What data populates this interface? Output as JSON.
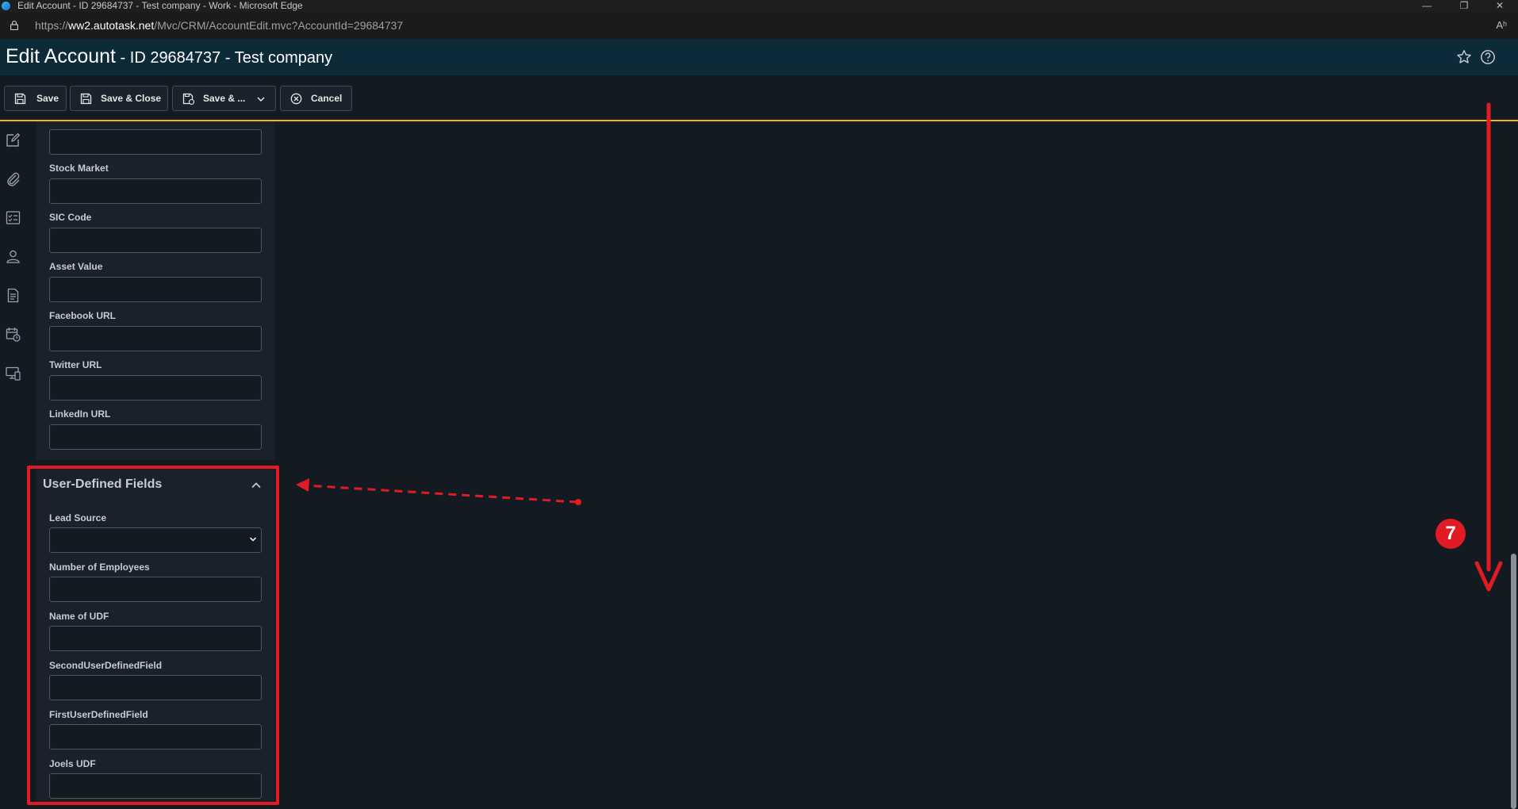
{
  "os": {
    "window_title": "Edit Account - ID 29684737 - Test company - Work - Microsoft Edge",
    "minimize": "—",
    "restore": "❐",
    "close": "✕"
  },
  "browser": {
    "url_prefix": "https://",
    "url_host": "ww2.autotask.net",
    "url_path": "/Mvc/CRM/AccountEdit.mvc?AccountId=29684737",
    "read_aloud": "Aʰ"
  },
  "header": {
    "title_main": "Edit Account",
    "title_sub": " - ID 29684737 - Test company"
  },
  "toolbar": {
    "save_label": "Save",
    "save_close_label": "Save & Close",
    "save_more_label": "Save & ...",
    "cancel_label": "Cancel"
  },
  "general_fields": [
    {
      "label": ""
    },
    {
      "label": "Stock Market"
    },
    {
      "label": "SIC Code"
    },
    {
      "label": "Asset Value"
    },
    {
      "label": "Facebook URL"
    },
    {
      "label": "Twitter URL"
    },
    {
      "label": "LinkedIn URL"
    }
  ],
  "udf": {
    "title": "User-Defined Fields",
    "lead_source_label": "Lead Source",
    "lead_source_value": "",
    "fields": [
      {
        "label": "Number of Employees"
      },
      {
        "label": "Name of UDF"
      },
      {
        "label": "SecondUserDefinedField"
      },
      {
        "label": "FirstUserDefinedField"
      },
      {
        "label": "Joels UDF"
      }
    ]
  },
  "annotation": {
    "step_number": "7",
    "color": "#e01b24"
  },
  "colors": {
    "header_bg": "#0d2a38",
    "page_bg": "#131a21",
    "accent_line": "#f2b705"
  }
}
